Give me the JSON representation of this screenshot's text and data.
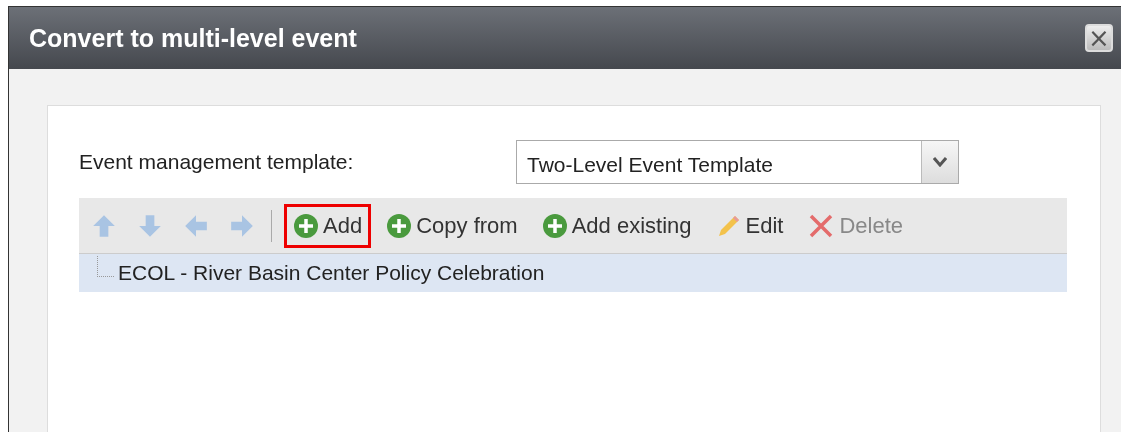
{
  "window": {
    "title": "Convert to multi-level event",
    "close_glyph": "×"
  },
  "template_field": {
    "label": "Event management template:",
    "value": "Two-Level Event Template"
  },
  "toolbar": {
    "items": [
      {
        "kind": "arrow-up",
        "disabled": true
      },
      {
        "kind": "arrow-down",
        "disabled": true
      },
      {
        "kind": "arrow-left",
        "disabled": true
      },
      {
        "kind": "arrow-right",
        "disabled": true
      },
      {
        "kind": "separator"
      },
      {
        "kind": "add",
        "label": "Add",
        "disabled": false,
        "highlighted": true
      },
      {
        "kind": "add",
        "label": "Copy from",
        "disabled": false,
        "highlighted": false
      },
      {
        "kind": "add",
        "label": "Add existing",
        "disabled": false,
        "highlighted": false
      },
      {
        "kind": "edit",
        "label": "Edit",
        "disabled": false,
        "highlighted": false
      },
      {
        "kind": "delete",
        "label": "Delete",
        "disabled": true,
        "highlighted": false
      }
    ]
  },
  "tree": {
    "items": [
      {
        "label": "ECOL - River Basin Center Policy Celebration",
        "selected": true
      }
    ]
  }
}
